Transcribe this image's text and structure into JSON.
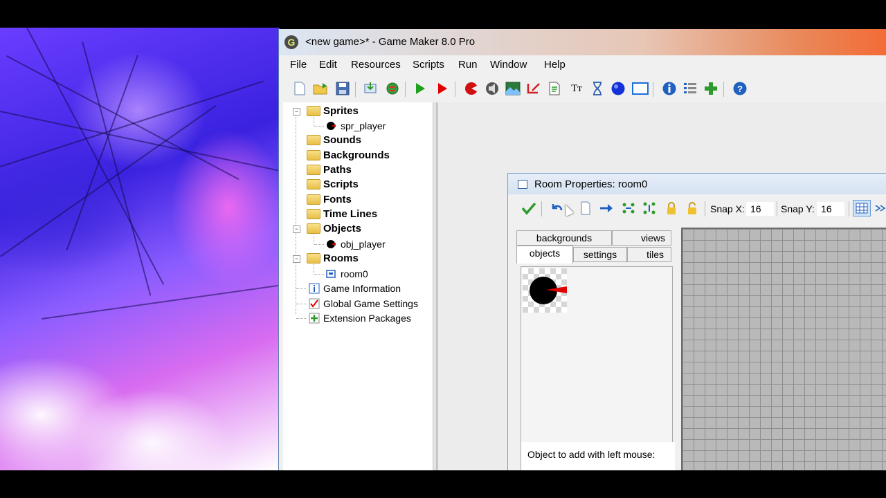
{
  "window": {
    "title": "<new game>* - Game Maker 8.0 Pro",
    "app_icon_letter": "G"
  },
  "menu": [
    "File",
    "Edit",
    "Resources",
    "Scripts",
    "Run",
    "Window",
    "Help"
  ],
  "toolbar": {
    "icons": [
      "new-icon",
      "open-icon",
      "save-icon",
      "create-executable-icon",
      "publish-icon",
      "run-icon",
      "run-debug-icon",
      "create-sprite-icon",
      "create-sound-icon",
      "create-background-icon",
      "create-path-icon",
      "create-script-icon",
      "create-font-icon",
      "create-timeline-icon",
      "create-object-icon",
      "create-room-icon",
      "game-information-icon",
      "global-game-settings-icon",
      "extension-packages-icon",
      "help-icon"
    ]
  },
  "tree": {
    "sprites": "Sprites",
    "spr_player": "spr_player",
    "sounds": "Sounds",
    "backgrounds": "Backgrounds",
    "paths": "Paths",
    "scripts": "Scripts",
    "fonts": "Fonts",
    "time_lines": "Time Lines",
    "objects": "Objects",
    "obj_player": "obj_player",
    "rooms": "Rooms",
    "room0": "room0",
    "game_information": "Game Information",
    "global_game_settings": "Global Game Settings",
    "extension_packages": "Extension Packages"
  },
  "room": {
    "title": "Room Properties: room0",
    "snap_x_label": "Snap X:",
    "snap_x": "16",
    "snap_y_label": "Snap Y:",
    "snap_y": "16",
    "tabs": {
      "backgrounds": "backgrounds",
      "views": "views",
      "objects": "objects",
      "settings": "settings",
      "tiles": "tiles"
    },
    "add_label": "Object to add with left mouse:"
  },
  "colors": {
    "accent_green": "#2e9a2e",
    "accent_red": "#e00000",
    "accent_blue": "#2060c0"
  }
}
